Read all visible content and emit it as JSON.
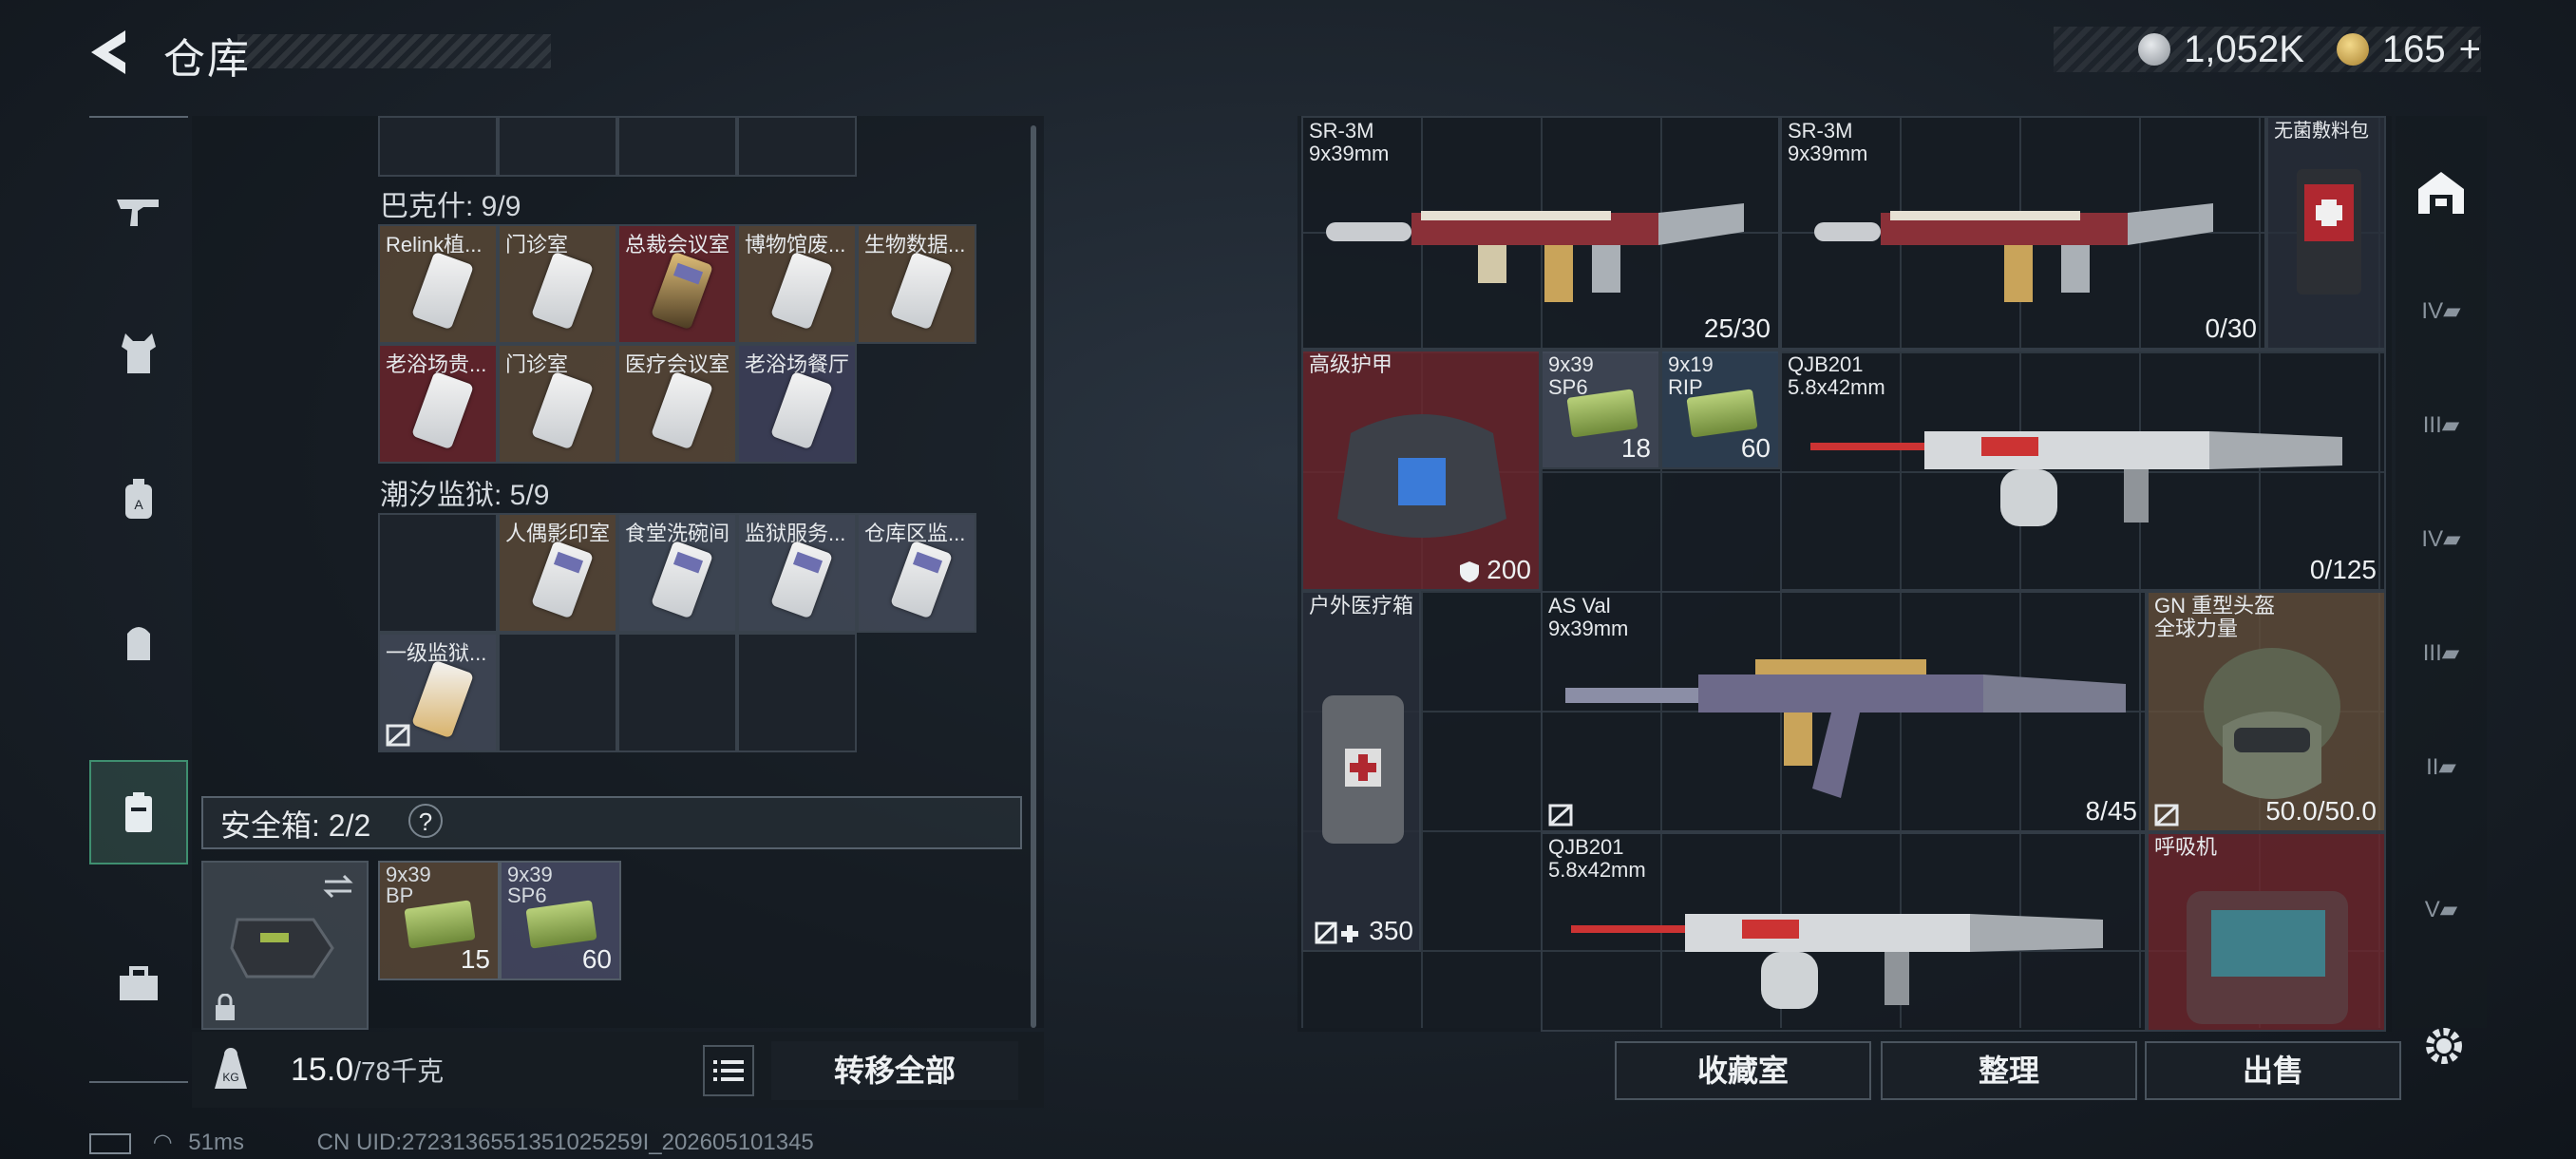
{
  "header": {
    "title": "仓库"
  },
  "currency": {
    "silver": "1,052K",
    "gold": "165",
    "plus": "+"
  },
  "left_nav": [
    "gun-icon",
    "armor-icon",
    "backpack-icon",
    "bag-icon",
    "safe-box-icon",
    "toolbox-icon"
  ],
  "keycards": {
    "top_partial_count": 3,
    "bakeshi": {
      "title": "巴克什: 9/9",
      "cards": [
        "Relink植...",
        "门诊室",
        "总裁会议室",
        "博物馆废...",
        "生物数据...",
        "老浴场贵...",
        "门诊室",
        "医疗会议室",
        "老浴场餐厅"
      ]
    },
    "chaoxi": {
      "title": "潮汐监狱: 5/9",
      "cards": [
        "",
        "人偶影印室",
        "食堂洗碗间",
        "监狱服务...",
        "仓库区监...",
        "一级监狱..."
      ]
    }
  },
  "safe": {
    "label": "安全箱: 2/2",
    "help": "?",
    "ammo": [
      {
        "label": "9x39\nBP",
        "count": "15"
      },
      {
        "label": "9x39\nSP6",
        "count": "60"
      }
    ]
  },
  "weight": {
    "current": "15.0",
    "max": "/78千克"
  },
  "buttons": {
    "transfer_all": "转移全部",
    "collection": "收藏室",
    "sort": "整理",
    "sell": "出售"
  },
  "status": {
    "ping": "51ms",
    "uid": "CN UID:2723136551351025259I_202605101345"
  },
  "stash": {
    "sr3m_1": {
      "name": "SR-3M\n9x39mm",
      "count": "25/30"
    },
    "sr3m_2": {
      "name": "SR-3M\n9x39mm",
      "count": "0/30"
    },
    "bag": {
      "name": "无菌敷料包"
    },
    "armor": {
      "name": "高级护甲",
      "durability": "200"
    },
    "ammo_sp6": {
      "name": "9x39\nSP6",
      "count": "18"
    },
    "ammo_rip": {
      "name": "9x19\nRIP",
      "count": "60"
    },
    "qjb_1": {
      "name": "QJB201\n5.8x42mm",
      "count": "0/125"
    },
    "medkit": {
      "name": "户外医疗箱",
      "hp": "350"
    },
    "asval": {
      "name": "AS Val\n9x39mm",
      "count": "8/45"
    },
    "helmet": {
      "name": "GN 重型头盔\n全球力量",
      "durability": "50.0/50.0"
    },
    "qjb_2": {
      "name": "QJB201\n5.8x42mm"
    },
    "respirator": {
      "name": "呼吸机"
    }
  }
}
